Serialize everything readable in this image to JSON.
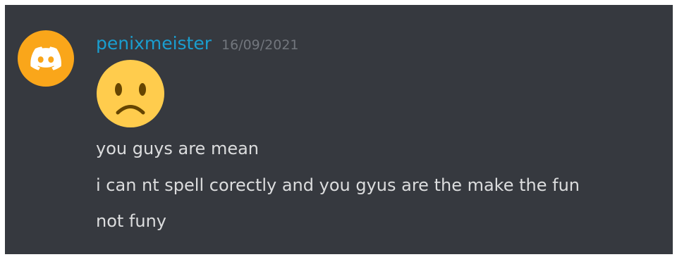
{
  "message": {
    "author": "penixmeister",
    "timestamp": "16/09/2021",
    "author_color": "#1a9ecf",
    "avatar": {
      "icon": "discord-logo-icon",
      "background": "#faa61a"
    },
    "emoji": "frowning-face-icon",
    "lines": [
      "you guys are mean",
      "i can nt spell corectly and you gyus are the make the fun",
      "not funy"
    ]
  },
  "colors": {
    "panel_background": "#36393f",
    "text": "#dcddde",
    "timestamp": "#72767d"
  }
}
